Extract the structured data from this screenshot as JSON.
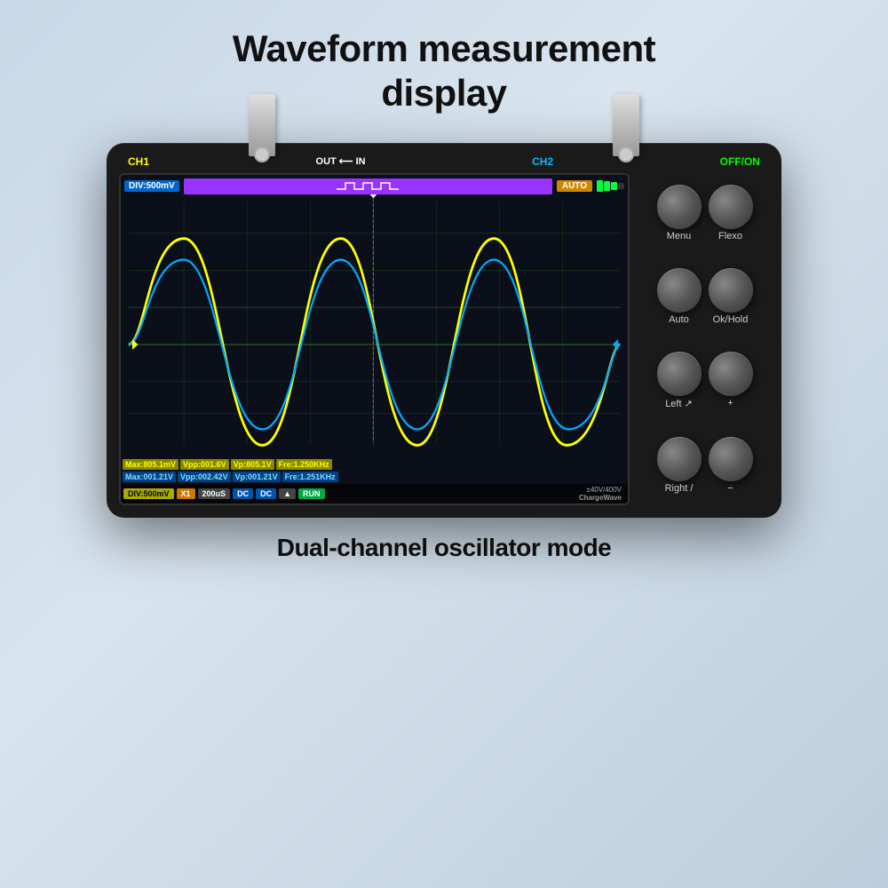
{
  "title": {
    "line1": "Waveform measurement",
    "line2": "display"
  },
  "subtitle": "Dual-channel oscillator mode",
  "device": {
    "labels": {
      "ch1": "CH1",
      "out_in": "OUT ⟵ IN",
      "ch2": "CH2",
      "off": "OFF",
      "on": "/ON"
    },
    "screen": {
      "div_badge": "DIV:500mV",
      "auto_badge": "AUTO",
      "meas_row1": [
        {
          "label": "Max:805.1mV",
          "type": "yellow"
        },
        {
          "label": "Vpp:001.6V",
          "type": "yellow"
        },
        {
          "label": "Vp:805.1V",
          "type": "yellow"
        },
        {
          "label": "Fre:1.250KHz",
          "type": "yellow"
        }
      ],
      "meas_row2": [
        {
          "label": "Max:001.21V",
          "type": "blue"
        },
        {
          "label": "Vpp:002.42V",
          "type": "blue"
        },
        {
          "label": "Vp:001.21V",
          "type": "blue"
        },
        {
          "label": "Fre:1.251KHz",
          "type": "blue"
        }
      ],
      "status_cells": [
        {
          "label": "DIV:500mV",
          "cls": "s-yellow"
        },
        {
          "label": "X1",
          "cls": "s-orange"
        },
        {
          "label": "200uS",
          "cls": "s-gray"
        },
        {
          "label": "DC",
          "cls": "s-blue"
        },
        {
          "label": "DC",
          "cls": "s-blue"
        },
        {
          "label": "▲",
          "cls": "s-gray"
        },
        {
          "label": "RUN",
          "cls": "s-green"
        }
      ],
      "voltage": "±40V/400V",
      "brand": "ChargeWave"
    },
    "buttons": [
      [
        {
          "label": "Menu"
        },
        {
          "label": "Flexo"
        }
      ],
      [
        {
          "label": "Auto"
        },
        {
          "label": "Ok/Hold"
        }
      ],
      [
        {
          "label": "Left ↗"
        },
        {
          "label": "+"
        }
      ],
      [
        {
          "label": "Right /"
        },
        {
          "label": "−"
        }
      ]
    ]
  }
}
